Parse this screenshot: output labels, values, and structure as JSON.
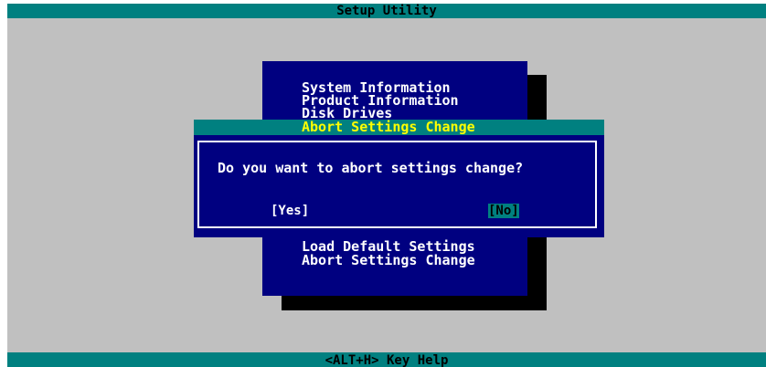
{
  "window": {
    "title": "Setup Utility",
    "status_hint": "<ALT+H>  Key Help"
  },
  "menu": {
    "items": [
      {
        "label": "System Information"
      },
      {
        "label": "Product Information"
      },
      {
        "label": "Disk Drives"
      },
      {
        "label": "Abort Settings Change",
        "selected": true
      },
      {
        "label": "Load Default Settings"
      },
      {
        "label": "Abort Settings Change"
      }
    ]
  },
  "dialog": {
    "question": "Do you want to abort settings change?",
    "yes_label": "[Yes]",
    "no_label": "[No]",
    "focused": "no"
  },
  "colors": {
    "background": "#c0c0c0",
    "bar": "#008080",
    "panel": "#000080",
    "highlight_text": "#ffff00",
    "text": "#ffffff"
  }
}
